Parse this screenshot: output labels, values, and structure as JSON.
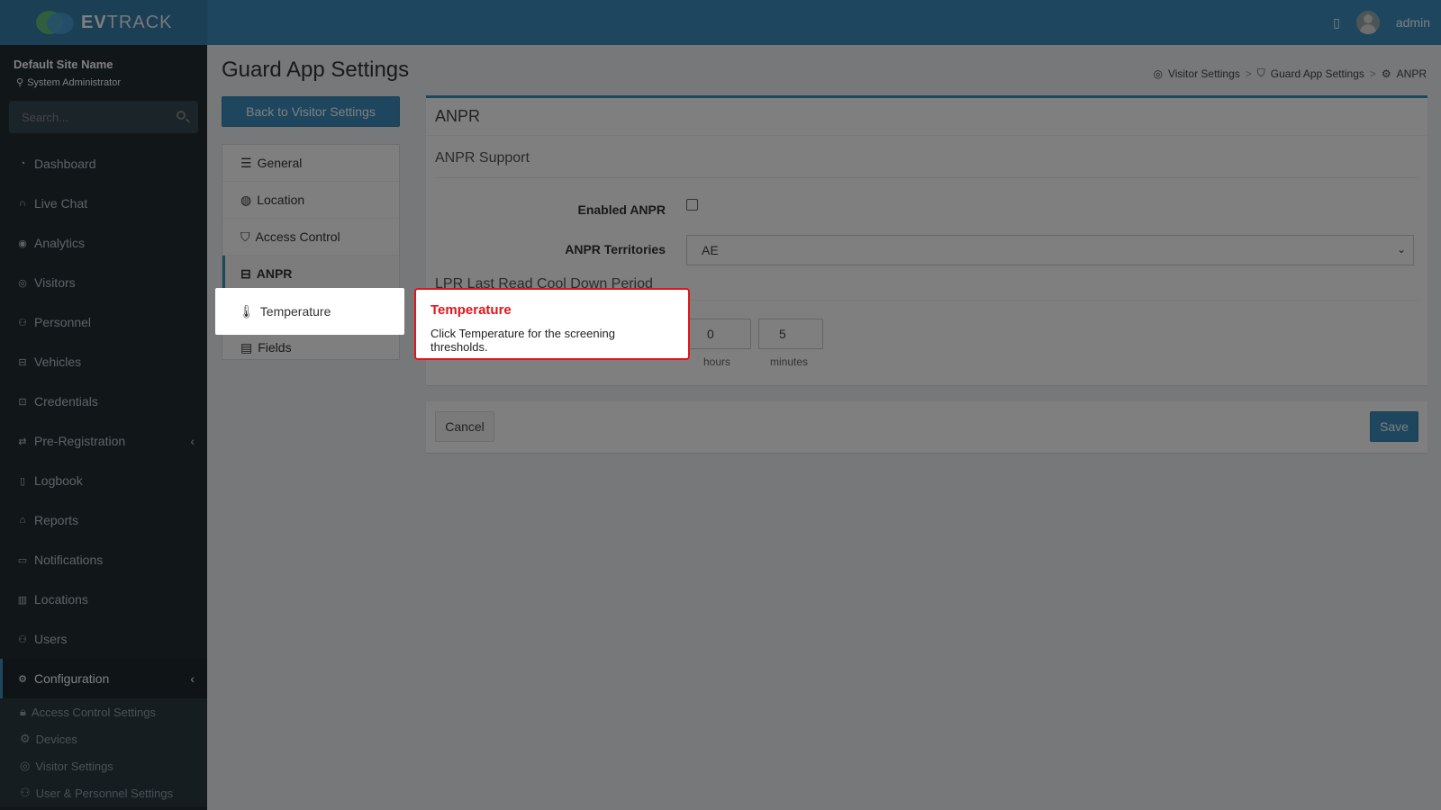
{
  "brand": {
    "name_bold": "EV",
    "name_light": "TRACK"
  },
  "topbar": {
    "user": "admin"
  },
  "sidebar": {
    "site_name": "Default Site Name",
    "role": "System Administrator",
    "search_placeholder": "Search...",
    "items": [
      {
        "label": "Dashboard",
        "icon": "dashboard-icon"
      },
      {
        "label": "Live Chat",
        "icon": "headset-icon"
      },
      {
        "label": "Analytics",
        "icon": "analytics-icon"
      },
      {
        "label": "Visitors",
        "icon": "eye-icon"
      },
      {
        "label": "Personnel",
        "icon": "personnel-icon"
      },
      {
        "label": "Vehicles",
        "icon": "car-icon"
      },
      {
        "label": "Credentials",
        "icon": "badge-icon"
      },
      {
        "label": "Pre-Registration",
        "icon": "exchange-icon"
      },
      {
        "label": "Logbook",
        "icon": "book-icon"
      },
      {
        "label": "Reports",
        "icon": "reports-icon"
      },
      {
        "label": "Notifications",
        "icon": "chat-icon"
      },
      {
        "label": "Locations",
        "icon": "map-icon"
      },
      {
        "label": "Users",
        "icon": "users-icon"
      },
      {
        "label": "Configuration",
        "icon": "gear-icon"
      }
    ],
    "submenu": [
      {
        "label": "Access Control Settings",
        "icon": "lock-icon"
      },
      {
        "label": "Devices",
        "icon": "gear-icon"
      },
      {
        "label": "Visitor Settings",
        "icon": "eye-icon"
      },
      {
        "label": "User & Personnel Settings",
        "icon": "users-icon"
      }
    ]
  },
  "page": {
    "title": "Guard App Settings",
    "breadcrumb": [
      "Visitor Settings",
      "Guard App Settings",
      "ANPR"
    ],
    "back_button": "Back to Visitor Settings"
  },
  "settings_nav": [
    {
      "label": "General",
      "icon": "sliders-icon"
    },
    {
      "label": "Location",
      "icon": "pin-icon"
    },
    {
      "label": "Access Control",
      "icon": "shield-icon"
    },
    {
      "label": "ANPR",
      "icon": "car-icon"
    },
    {
      "label": "Temperature",
      "icon": "thermometer-icon"
    },
    {
      "label": "Fields",
      "icon": "form-icon"
    }
  ],
  "panel": {
    "title": "ANPR",
    "section": "ANPR Support",
    "enabled_label": "Enabled ANPR",
    "enabled_value": false,
    "territories_label": "ANPR Territories",
    "territories_value": "AE",
    "cooldown_section": "LPR Last Read Cool Down Period",
    "hours_value": "0",
    "hours_label": "hours",
    "minutes_value": "5",
    "minutes_label": "minutes"
  },
  "footer": {
    "cancel": "Cancel",
    "save": "Save"
  },
  "tooltip": {
    "title": "Temperature",
    "text": "Click Temperature for the screening thresholds."
  }
}
